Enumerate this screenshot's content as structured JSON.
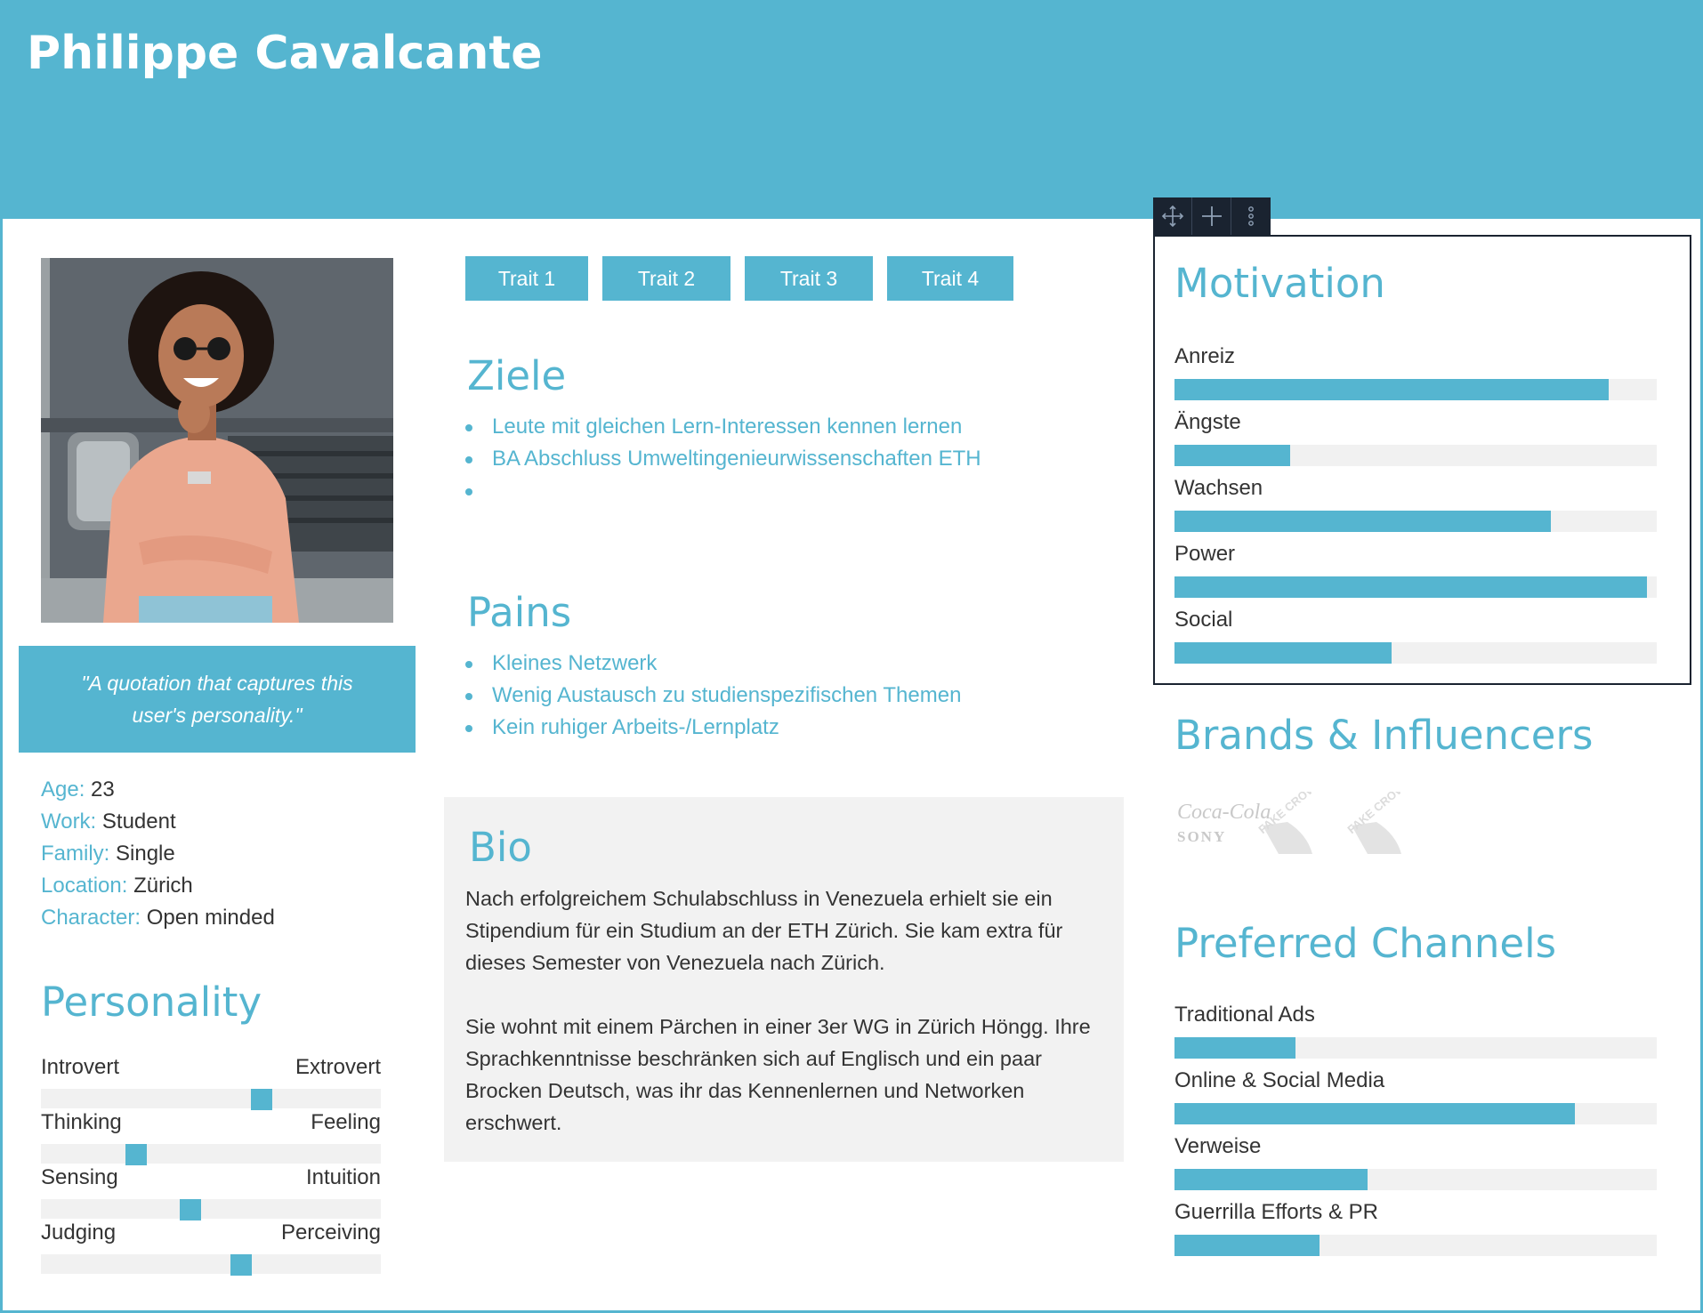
{
  "persona": {
    "name": "Philippe Cavalcante",
    "quote": "\"A quotation that captures this user's personality.\"",
    "demographics": [
      {
        "key": "Age:",
        "value": "23"
      },
      {
        "key": "Work:",
        "value": "Student"
      },
      {
        "key": "Family:",
        "value": "Single"
      },
      {
        "key": "Location:",
        "value": "Zürich"
      },
      {
        "key": "Character:",
        "value": "Open minded"
      }
    ]
  },
  "personality": {
    "title": "Personality",
    "scales": [
      {
        "left": "Introvert",
        "right": "Extrovert",
        "position": 0.65
      },
      {
        "left": "Thinking",
        "right": "Feeling",
        "position": 0.28
      },
      {
        "left": "Sensing",
        "right": "Intuition",
        "position": 0.44
      },
      {
        "left": "Judging",
        "right": "Perceiving",
        "position": 0.59
      }
    ]
  },
  "traits": [
    "Trait 1",
    "Trait 2",
    "Trait 3",
    "Trait 4"
  ],
  "goals": {
    "title": "Ziele",
    "items": [
      "Leute mit gleichen Lern-Interessen kennen lernen",
      "BA Abschluss Umweltingenieurwissenschaften ETH",
      ""
    ]
  },
  "pains": {
    "title": "Pains",
    "items": [
      "Kleines Netzwerk",
      "Wenig Austausch zu studienspezifischen Themen",
      "Kein ruhiger Arbeits-/Lernplatz"
    ]
  },
  "bio": {
    "title": "Bio",
    "paragraph1": "Nach erfolgreichem Schulabschluss in Venezuela erhielt sie ein Stipendium für ein Studium an der ETH Zürich. Sie kam extra für dieses Semester von Venezuela nach Zürich.",
    "paragraph2": "Sie wohnt mit einem Pärchen in einer 3er WG in Zürich Höngg. Ihre Sprachkenntnisse beschränken sich auf Englisch und ein paar Brocken Deutsch, was ihr das Kennenlernen und Networken erschwert."
  },
  "motivation": {
    "title": "Motivation",
    "bars": [
      {
        "label": "Anreiz",
        "value": 0.9
      },
      {
        "label": "Ängste",
        "value": 0.24
      },
      {
        "label": "Wachsen",
        "value": 0.78
      },
      {
        "label": "Power",
        "value": 0.98
      },
      {
        "label": "Social",
        "value": 0.45
      }
    ]
  },
  "brands": {
    "title": "Brands & Influencers",
    "logos": [
      "Coca-Cola",
      "SONY",
      "FAKE CROW",
      "FAKE CROW"
    ]
  },
  "channels": {
    "title": "Preferred Channels",
    "bars": [
      {
        "label": "Traditional Ads",
        "value": 0.25
      },
      {
        "label": "Online & Social Media",
        "value": 0.83
      },
      {
        "label": "Verweise",
        "value": 0.4
      },
      {
        "label": "Guerrilla Efforts & PR",
        "value": 0.3
      }
    ]
  },
  "toolbar": {
    "icons": [
      "move-icon",
      "plus-icon",
      "more-vertical-icon"
    ]
  },
  "colors": {
    "accent": "#55b5d0",
    "track": "#f1f1f1",
    "bio_background": "#f2f2f2",
    "toolbar": "#1a2330"
  }
}
